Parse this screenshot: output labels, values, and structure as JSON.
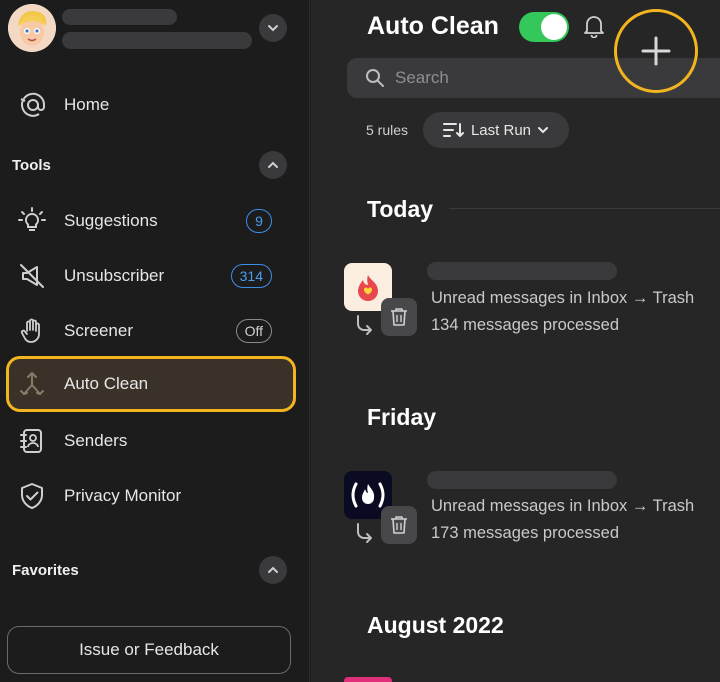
{
  "sidebar": {
    "home_label": "Home",
    "tools_title": "Tools",
    "items": [
      {
        "label": "Suggestions",
        "badge": "9"
      },
      {
        "label": "Unsubscriber",
        "badge": "314"
      },
      {
        "label": "Screener",
        "badge": "Off"
      },
      {
        "label": "Auto Clean"
      },
      {
        "label": "Senders"
      },
      {
        "label": "Privacy Monitor"
      }
    ],
    "favorites_title": "Favorites",
    "feedback_label": "Issue or Feedback"
  },
  "main": {
    "title": "Auto Clean",
    "toggle_on": true,
    "search_placeholder": "Search",
    "rules_count": "5 rules",
    "sort_label": "Last Run",
    "groups": [
      {
        "title": "Today",
        "rule": {
          "line1": "Unread messages in Inbox → Trash",
          "line2": "134 messages processed"
        }
      },
      {
        "title": "Friday",
        "rule": {
          "line1": "Unread messages in Inbox → Trash",
          "line2": "173 messages processed"
        }
      },
      {
        "title": "August 2022"
      }
    ]
  },
  "colors": {
    "accent_highlight": "#f3b51f",
    "toggle_green": "#34c759",
    "badge_blue": "#3d8ee8"
  }
}
